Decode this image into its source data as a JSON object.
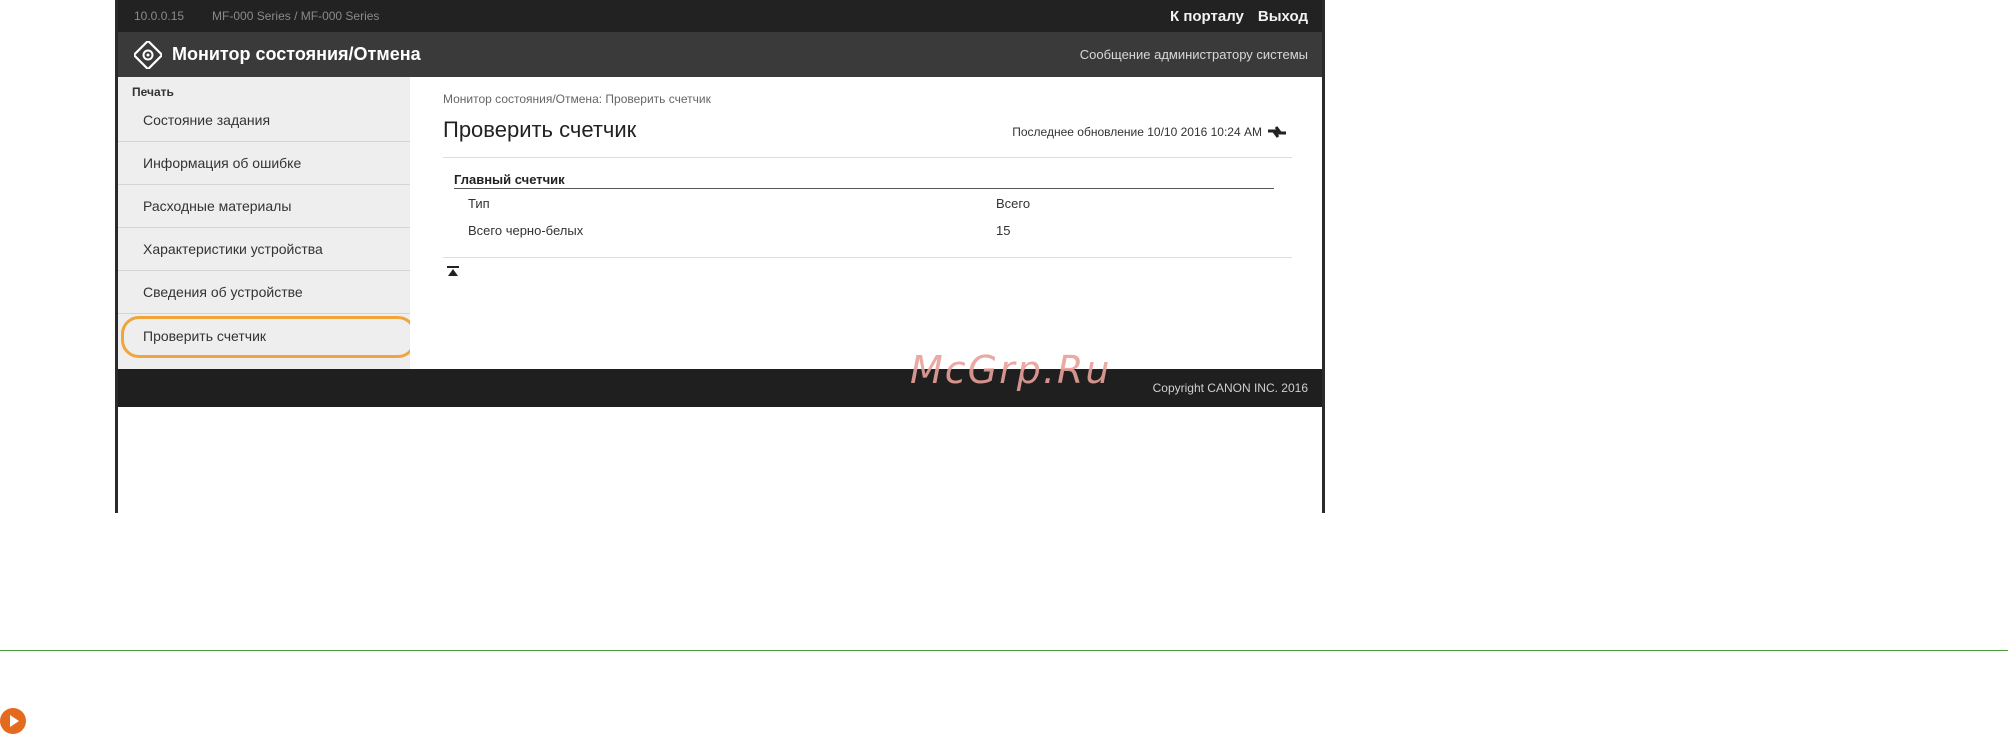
{
  "topbar": {
    "info_left": "10.0.0.15",
    "info_mid": "MF-000 Series / MF-000 Series",
    "portal_link": "К порталу",
    "logout_link": "Выход"
  },
  "titlebar": {
    "title": "Монитор состояния/Отмена",
    "admin_message": "Сообщение администратору системы"
  },
  "sidebar": {
    "group_label": "Печать",
    "items": [
      {
        "label": "Состояние задания"
      },
      {
        "label": "Информация об ошибке"
      },
      {
        "label": "Расходные материалы"
      },
      {
        "label": "Характеристики устройства"
      },
      {
        "label": "Сведения об устройстве"
      },
      {
        "label": "Проверить счетчик"
      }
    ],
    "active_color": "#f0a53c"
  },
  "main": {
    "breadcrumb": "Монитор состояния/Отмена: Проверить счетчик",
    "heading": "Проверить счетчик",
    "last_update": "Последнее обновление 10/10 2016 10:24 AM",
    "table_title": "Главный счетчик",
    "columns": [
      "Тип",
      "Всего"
    ],
    "rows": [
      [
        "Всего черно-белых",
        "15"
      ]
    ]
  },
  "footer": {
    "copyright": "Copyright CANON INC. 2016"
  },
  "watermark": "McGrp.Ru",
  "colors": {
    "topbar": "#222222",
    "titlebar": "#3a3a3a",
    "sidebar": "#eeeeee",
    "highlight": "#f0a53c",
    "separator": "#4a9a3a",
    "bullet": "#e46a1e"
  }
}
